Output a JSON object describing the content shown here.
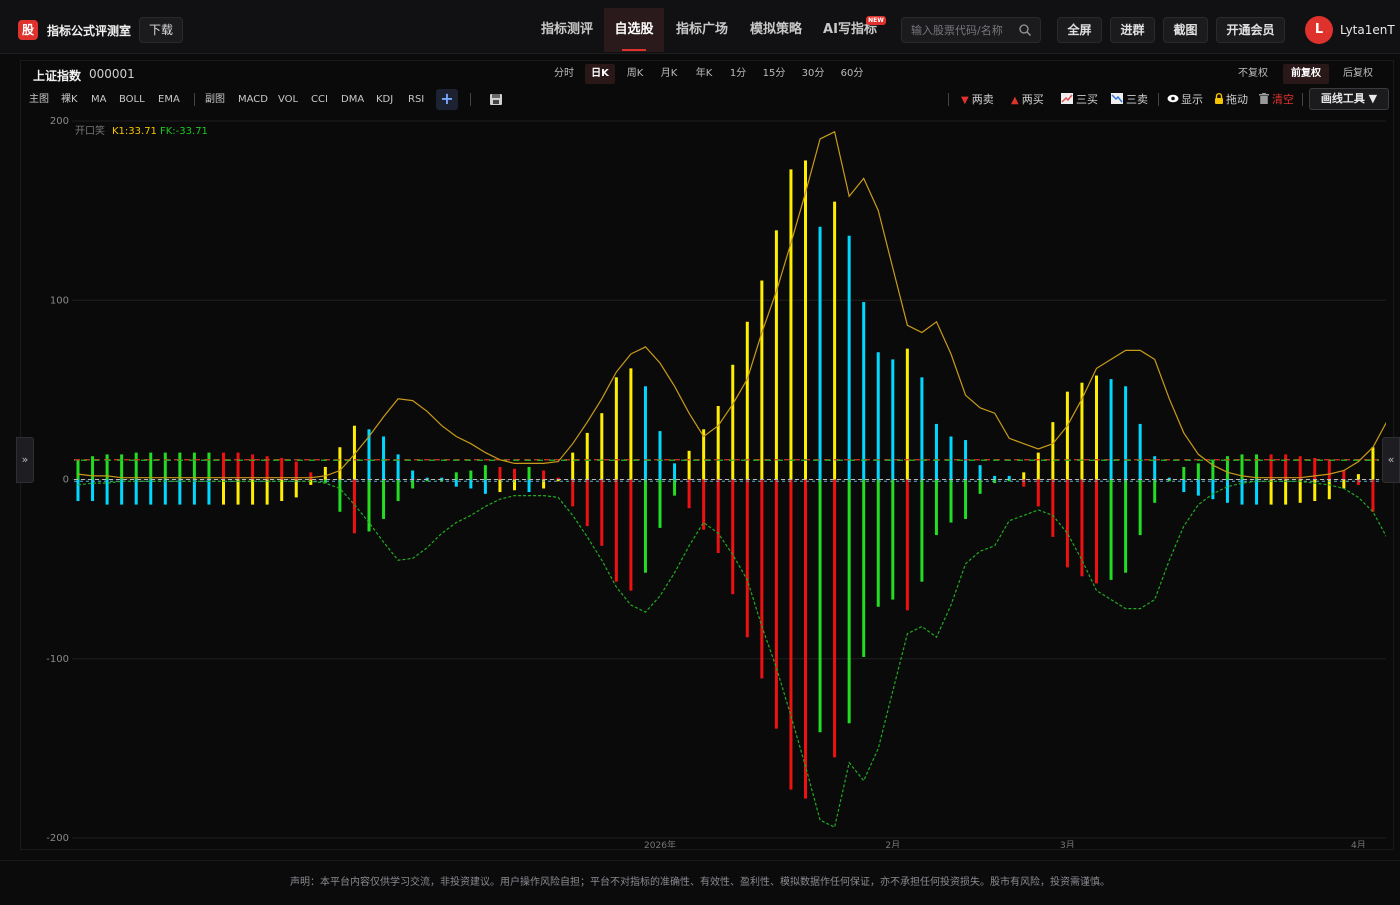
{
  "app": {
    "logo_char": "股",
    "title": "指标公式评测室",
    "download": "下载"
  },
  "nav": [
    {
      "label": "指标测评",
      "active": false
    },
    {
      "label": "自选股",
      "active": true
    },
    {
      "label": "指标广场",
      "active": false
    },
    {
      "label": "模拟策略",
      "active": false
    },
    {
      "label": "AI写指标",
      "active": false,
      "badge": "NEW"
    }
  ],
  "search": {
    "placeholder": "输入股票代码/名称"
  },
  "top_buttons": [
    "全屏",
    "进群",
    "截图",
    "开通会员"
  ],
  "user": {
    "avatar_letter": "L",
    "name": "Lyta1enT"
  },
  "stock": {
    "name": "上证指数",
    "code": "000001"
  },
  "periods": [
    {
      "label": "分时",
      "active": false
    },
    {
      "label": "日K",
      "active": true
    },
    {
      "label": "周K",
      "active": false
    },
    {
      "label": "月K",
      "active": false
    },
    {
      "label": "年K",
      "active": false
    },
    {
      "label": "1分",
      "active": false
    },
    {
      "label": "15分",
      "active": false
    },
    {
      "label": "30分",
      "active": false
    },
    {
      "label": "60分",
      "active": false
    }
  ],
  "adjust": [
    {
      "label": "不复权",
      "active": false
    },
    {
      "label": "前复权",
      "active": true
    },
    {
      "label": "后复权",
      "active": false
    }
  ],
  "main_indicators": [
    "主图",
    "裸K",
    "MA",
    "BOLL",
    "EMA"
  ],
  "sub_indicators": [
    "副图",
    "MACD",
    "VOL",
    "CCI",
    "DMA",
    "KDJ",
    "RSI"
  ],
  "tools": [
    {
      "label": "两卖",
      "icon": "down-triangle-icon",
      "color": "#e0322c"
    },
    {
      "label": "两买",
      "icon": "up-triangle-icon",
      "color": "#e0322c"
    },
    {
      "label": "三买",
      "icon": "line-chart-icon",
      "color": "#e05050"
    },
    {
      "label": "三卖",
      "icon": "line-chart-alt-icon",
      "color": "#5aa0ff"
    },
    {
      "label": "显示",
      "icon": "eye-icon",
      "color": "#ffffff"
    },
    {
      "label": "拖动",
      "icon": "lock-icon",
      "color": "#f5c400"
    },
    {
      "label": "清空",
      "icon": "trash-icon",
      "color": "#e0322c"
    }
  ],
  "draw_tool": "画线工具 ▼",
  "side_left": "»",
  "side_right": "«",
  "chart_data": {
    "type": "bar",
    "indicator_name": "开口笑",
    "legend": [
      {
        "label": "K1:33.71",
        "color": "#f5c400"
      },
      {
        "label": "FK:-33.71",
        "color": "#1ec81e"
      }
    ],
    "ylim": [
      -200,
      200
    ],
    "yticks": [
      200,
      100,
      0,
      -100,
      -200
    ],
    "x_tick_labels": [
      {
        "label": "2026年",
        "index": 40
      },
      {
        "label": "2月",
        "index": 56
      },
      {
        "label": "3月",
        "index": 68
      },
      {
        "label": "4月",
        "index": 88
      }
    ],
    "reference_levels": {
      "upper": 11,
      "middle": 11,
      "lower": -1,
      "zero": 0
    },
    "bar_colors": {
      "Y": "#ffee00",
      "C": "#00d8ff",
      "G": "#22dd22",
      "R": "#ee1111"
    },
    "bars": [
      {
        "up": 11,
        "down": -12,
        "uc": "G",
        "dc": "C"
      },
      {
        "up": 13,
        "down": -12,
        "uc": "G",
        "dc": "C"
      },
      {
        "up": 14,
        "down": -14,
        "uc": "G",
        "dc": "C"
      },
      {
        "up": 14,
        "down": -14,
        "uc": "G",
        "dc": "C"
      },
      {
        "up": 15,
        "down": -14,
        "uc": "G",
        "dc": "C"
      },
      {
        "up": 15,
        "down": -14,
        "uc": "G",
        "dc": "C"
      },
      {
        "up": 15,
        "down": -14,
        "uc": "G",
        "dc": "C"
      },
      {
        "up": 15,
        "down": -14,
        "uc": "G",
        "dc": "C"
      },
      {
        "up": 15,
        "down": -14,
        "uc": "G",
        "dc": "C"
      },
      {
        "up": 15,
        "down": -14,
        "uc": "G",
        "dc": "C"
      },
      {
        "up": 15,
        "down": -14,
        "uc": "R",
        "dc": "Y"
      },
      {
        "up": 15,
        "down": -14,
        "uc": "R",
        "dc": "Y"
      },
      {
        "up": 14,
        "down": -14,
        "uc": "R",
        "dc": "Y"
      },
      {
        "up": 13,
        "down": -14,
        "uc": "R",
        "dc": "Y"
      },
      {
        "up": 12,
        "down": -12,
        "uc": "R",
        "dc": "Y"
      },
      {
        "up": 10,
        "down": -10,
        "uc": "R",
        "dc": "Y"
      },
      {
        "up": 4,
        "down": -3,
        "uc": "R",
        "dc": "Y"
      },
      {
        "up": 7,
        "down": -2,
        "uc": "Y",
        "dc": "G"
      },
      {
        "up": 18,
        "down": -18,
        "uc": "Y",
        "dc": "G"
      },
      {
        "up": 30,
        "down": -30,
        "uc": "Y",
        "dc": "R"
      },
      {
        "up": 28,
        "down": -29,
        "uc": "C",
        "dc": "G"
      },
      {
        "up": 24,
        "down": -22,
        "uc": "C",
        "dc": "G"
      },
      {
        "up": 14,
        "down": -12,
        "uc": "C",
        "dc": "G"
      },
      {
        "up": 5,
        "down": -5,
        "uc": "C",
        "dc": "G"
      },
      {
        "up": 1,
        "down": -1,
        "uc": "C",
        "dc": "G"
      },
      {
        "up": 1,
        "down": -1,
        "uc": "C",
        "dc": "G"
      },
      {
        "up": 4,
        "down": -4,
        "uc": "G",
        "dc": "C"
      },
      {
        "up": 5,
        "down": -5,
        "uc": "G",
        "dc": "C"
      },
      {
        "up": 8,
        "down": -8,
        "uc": "G",
        "dc": "C"
      },
      {
        "up": 7,
        "down": -7,
        "uc": "R",
        "dc": "Y"
      },
      {
        "up": 6,
        "down": -6,
        "uc": "R",
        "dc": "Y"
      },
      {
        "up": 7,
        "down": -7,
        "uc": "G",
        "dc": "C"
      },
      {
        "up": 5,
        "down": -5,
        "uc": "R",
        "dc": "Y"
      },
      {
        "up": 1,
        "down": -1,
        "uc": "R",
        "dc": "Y"
      },
      {
        "up": 15,
        "down": -15,
        "uc": "Y",
        "dc": "R"
      },
      {
        "up": 26,
        "down": -26,
        "uc": "Y",
        "dc": "R"
      },
      {
        "up": 37,
        "down": -37,
        "uc": "Y",
        "dc": "R"
      },
      {
        "up": 57,
        "down": -57,
        "uc": "Y",
        "dc": "R"
      },
      {
        "up": 62,
        "down": -62,
        "uc": "Y",
        "dc": "R"
      },
      {
        "up": 52,
        "down": -52,
        "uc": "C",
        "dc": "G"
      },
      {
        "up": 27,
        "down": -27,
        "uc": "C",
        "dc": "G"
      },
      {
        "up": 9,
        "down": -9,
        "uc": "C",
        "dc": "G"
      },
      {
        "up": 16,
        "down": -16,
        "uc": "Y",
        "dc": "R"
      },
      {
        "up": 28,
        "down": -28,
        "uc": "Y",
        "dc": "R"
      },
      {
        "up": 41,
        "down": -41,
        "uc": "Y",
        "dc": "R"
      },
      {
        "up": 64,
        "down": -64,
        "uc": "Y",
        "dc": "R"
      },
      {
        "up": 88,
        "down": -88,
        "uc": "Y",
        "dc": "R"
      },
      {
        "up": 111,
        "down": -111,
        "uc": "Y",
        "dc": "R"
      },
      {
        "up": 139,
        "down": -139,
        "uc": "Y",
        "dc": "R"
      },
      {
        "up": 173,
        "down": -173,
        "uc": "Y",
        "dc": "R"
      },
      {
        "up": 178,
        "down": -178,
        "uc": "Y",
        "dc": "R"
      },
      {
        "up": 141,
        "down": -141,
        "uc": "C",
        "dc": "G"
      },
      {
        "up": 155,
        "down": -155,
        "uc": "Y",
        "dc": "R"
      },
      {
        "up": 136,
        "down": -136,
        "uc": "C",
        "dc": "G"
      },
      {
        "up": 99,
        "down": -99,
        "uc": "C",
        "dc": "G"
      },
      {
        "up": 71,
        "down": -71,
        "uc": "C",
        "dc": "G"
      },
      {
        "up": 67,
        "down": -67,
        "uc": "C",
        "dc": "G"
      },
      {
        "up": 73,
        "down": -73,
        "uc": "Y",
        "dc": "R"
      },
      {
        "up": 57,
        "down": -57,
        "uc": "C",
        "dc": "G"
      },
      {
        "up": 31,
        "down": -31,
        "uc": "C",
        "dc": "G"
      },
      {
        "up": 24,
        "down": -24,
        "uc": "C",
        "dc": "G"
      },
      {
        "up": 22,
        "down": -22,
        "uc": "C",
        "dc": "G"
      },
      {
        "up": 8,
        "down": -8,
        "uc": "C",
        "dc": "G"
      },
      {
        "up": 2,
        "down": -2,
        "uc": "C",
        "dc": "G"
      },
      {
        "up": 2,
        "down": -1,
        "uc": "C",
        "dc": "G"
      },
      {
        "up": 4,
        "down": -4,
        "uc": "Y",
        "dc": "R"
      },
      {
        "up": 15,
        "down": -15,
        "uc": "Y",
        "dc": "R"
      },
      {
        "up": 32,
        "down": -32,
        "uc": "Y",
        "dc": "R"
      },
      {
        "up": 49,
        "down": -49,
        "uc": "Y",
        "dc": "R"
      },
      {
        "up": 54,
        "down": -54,
        "uc": "Y",
        "dc": "R"
      },
      {
        "up": 58,
        "down": -58,
        "uc": "Y",
        "dc": "R"
      },
      {
        "up": 56,
        "down": -56,
        "uc": "C",
        "dc": "G"
      },
      {
        "up": 52,
        "down": -52,
        "uc": "C",
        "dc": "G"
      },
      {
        "up": 31,
        "down": -31,
        "uc": "C",
        "dc": "G"
      },
      {
        "up": 13,
        "down": -13,
        "uc": "C",
        "dc": "G"
      },
      {
        "up": 1,
        "down": -1,
        "uc": "C",
        "dc": "G"
      },
      {
        "up": 7,
        "down": -7,
        "uc": "G",
        "dc": "C"
      },
      {
        "up": 9,
        "down": -9,
        "uc": "G",
        "dc": "C"
      },
      {
        "up": 11,
        "down": -11,
        "uc": "G",
        "dc": "C"
      },
      {
        "up": 13,
        "down": -13,
        "uc": "G",
        "dc": "C"
      },
      {
        "up": 14,
        "down": -14,
        "uc": "G",
        "dc": "C"
      },
      {
        "up": 14,
        "down": -14,
        "uc": "G",
        "dc": "C"
      },
      {
        "up": 14,
        "down": -14,
        "uc": "R",
        "dc": "Y"
      },
      {
        "up": 14,
        "down": -14,
        "uc": "R",
        "dc": "Y"
      },
      {
        "up": 13,
        "down": -13,
        "uc": "R",
        "dc": "Y"
      },
      {
        "up": 12,
        "down": -12,
        "uc": "R",
        "dc": "Y"
      },
      {
        "up": 11,
        "down": -11,
        "uc": "R",
        "dc": "Y"
      },
      {
        "up": 5,
        "down": -5,
        "uc": "R",
        "dc": "Y"
      },
      {
        "up": 3,
        "down": -3,
        "uc": "Y",
        "dc": "R"
      },
      {
        "up": 18,
        "down": -18,
        "uc": "Y",
        "dc": "R"
      }
    ],
    "upper_envelope": [
      3,
      2,
      2,
      1,
      1,
      1,
      1,
      1,
      1,
      1,
      1,
      1,
      1,
      1,
      1,
      1,
      1,
      2,
      5,
      14,
      24,
      35,
      45,
      44,
      38,
      30,
      24,
      20,
      15,
      11,
      9,
      9,
      9,
      10,
      20,
      32,
      45,
      60,
      70,
      74,
      65,
      52,
      37,
      24,
      30,
      42,
      56,
      82,
      105,
      132,
      160,
      190,
      194,
      158,
      168,
      150,
      118,
      86,
      82,
      88,
      70,
      47,
      40,
      37,
      23,
      20,
      17,
      20,
      30,
      45,
      62,
      67,
      72,
      72,
      67,
      45,
      26,
      14,
      8,
      4,
      2,
      1,
      1,
      1,
      1,
      2,
      3,
      5,
      10,
      18,
      33
    ],
    "lower_envelope": [
      -3,
      -2,
      -2,
      -1,
      -1,
      -1,
      -1,
      -1,
      -1,
      -1,
      -1,
      -1,
      -1,
      -1,
      -1,
      -1,
      -1,
      -2,
      -5,
      -14,
      -24,
      -35,
      -45,
      -44,
      -38,
      -30,
      -24,
      -20,
      -15,
      -11,
      -9,
      -9,
      -9,
      -10,
      -20,
      -32,
      -45,
      -60,
      -70,
      -74,
      -65,
      -52,
      -37,
      -24,
      -30,
      -42,
      -56,
      -82,
      -105,
      -132,
      -160,
      -190,
      -194,
      -158,
      -168,
      -150,
      -118,
      -86,
      -82,
      -88,
      -70,
      -47,
      -40,
      -37,
      -23,
      -20,
      -17,
      -20,
      -30,
      -45,
      -62,
      -67,
      -72,
      -72,
      -67,
      -45,
      -26,
      -14,
      -8,
      -4,
      -2,
      -1,
      -1,
      -1,
      -1,
      -2,
      -3,
      -5,
      -10,
      -18,
      -33
    ]
  },
  "footer": "声明：本平台内容仅供学习交流，非投资建议。用户操作风险自担；平台不对指标的准确性、有效性、盈利性、模拟数据作任何保证，亦不承担任何投资损失。股市有风险，投资需谨慎。"
}
